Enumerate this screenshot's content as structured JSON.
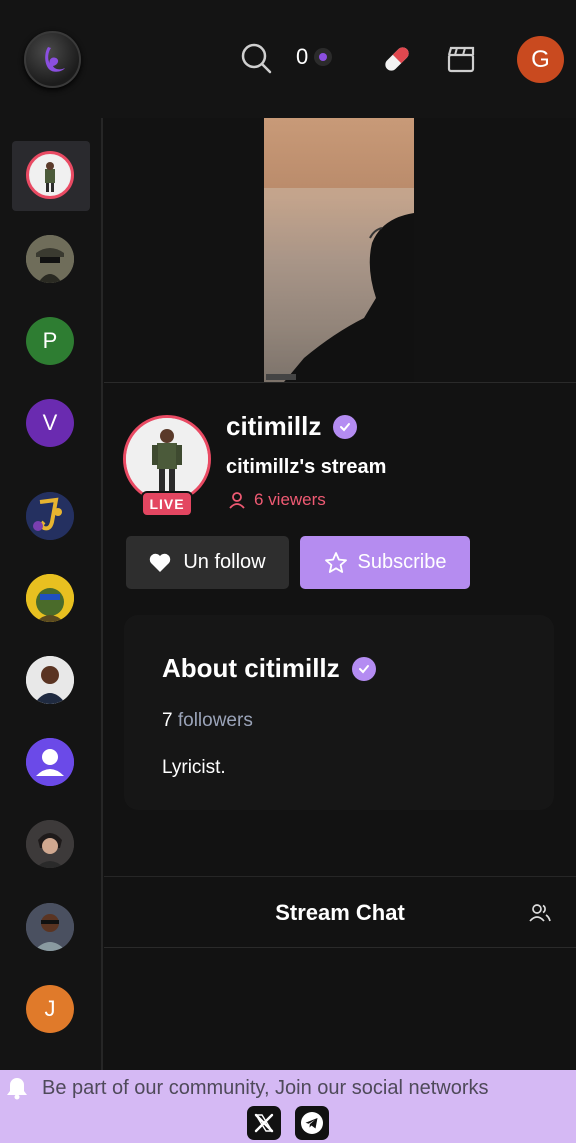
{
  "header": {
    "coin_count": "0",
    "user_initial": "G"
  },
  "sidebar": {
    "items": [
      {
        "type": "image",
        "name": "citimillz"
      },
      {
        "type": "image",
        "name": "channel-2"
      },
      {
        "type": "initial",
        "label": "P",
        "color": "#2e7d32"
      },
      {
        "type": "initial",
        "label": "V",
        "color": "#6a2bb0"
      },
      {
        "type": "image",
        "name": "channel-5"
      },
      {
        "type": "image",
        "name": "channel-6"
      },
      {
        "type": "image",
        "name": "channel-7"
      },
      {
        "type": "image",
        "name": "channel-8"
      },
      {
        "type": "image",
        "name": "channel-9"
      },
      {
        "type": "image",
        "name": "channel-10"
      },
      {
        "type": "initial",
        "label": "J",
        "color": "#e07a2a"
      }
    ]
  },
  "stream": {
    "streamer_name": "citimillz",
    "title": "citimillz's stream",
    "live_label": "LIVE",
    "viewers": "6 viewers",
    "unfollow_label": "Un follow",
    "subscribe_label": "Subscribe"
  },
  "about": {
    "title": "About citimillz",
    "followers_count": "7",
    "followers_label": "followers",
    "bio": "Lyricist."
  },
  "chat": {
    "title": "Stream Chat"
  },
  "banner": {
    "text": "Be part of our community, Join our social networks"
  },
  "colors": {
    "accent": "#b58cf0",
    "live": "#e34661",
    "background": "#121212"
  }
}
